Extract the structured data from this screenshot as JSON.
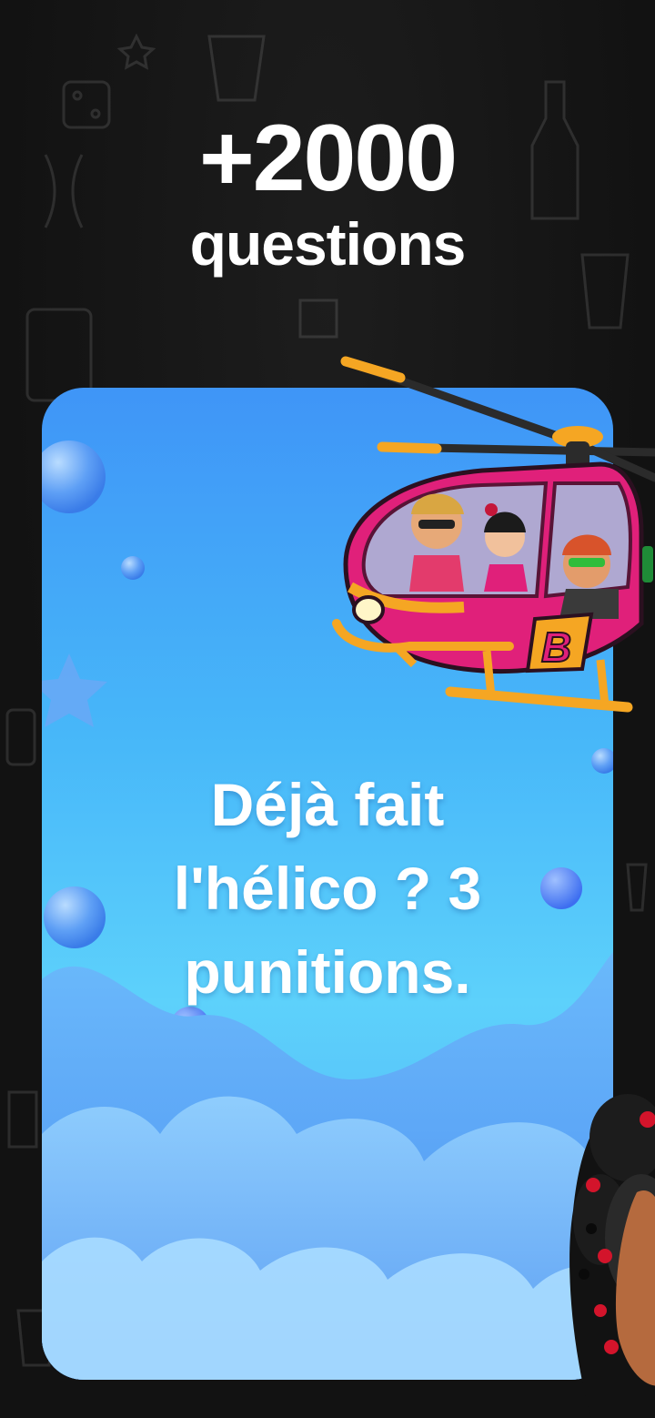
{
  "headline": {
    "count": "+2000",
    "label": "questions"
  },
  "card": {
    "question": "Déjà fait\nl'hélico ? 3\npunitions."
  },
  "icons": [
    "helicopter-illustration",
    "party-character-illustration",
    "star-icon"
  ],
  "colors": {
    "background": "#141414",
    "card_top": "#3f95f7",
    "card_mid": "#5dd1fb",
    "text": "#ffffff",
    "helicopter_body": "#e0207a",
    "helicopter_accent": "#f5a623"
  }
}
